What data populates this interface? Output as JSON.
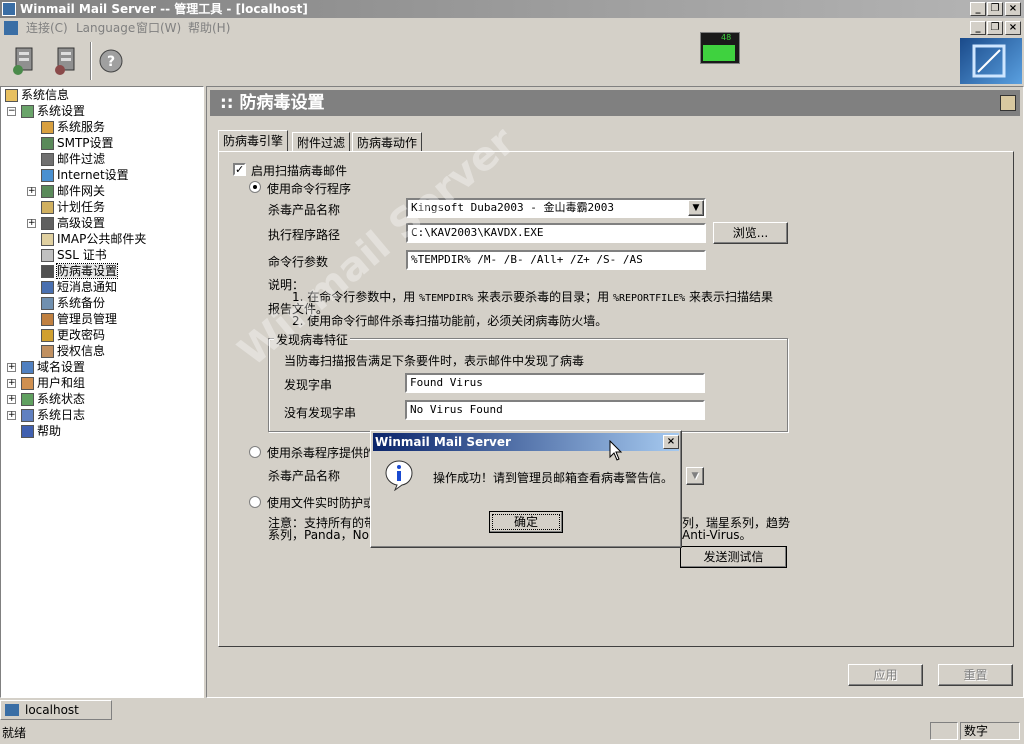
{
  "window": {
    "title": "Winmail Mail Server -- 管理工具 - [localhost]"
  },
  "menu": [
    {
      "label": "连接(C)"
    },
    {
      "label": "Language"
    },
    {
      "label": "窗口(W)"
    },
    {
      "label": "帮助(H)"
    }
  ],
  "graph": {
    "value": "48"
  },
  "tree": {
    "root": "系统信息",
    "settings": "系统设置",
    "items": [
      "系统服务",
      "SMTP设置",
      "邮件过滤",
      "Internet设置",
      "邮件网关",
      "计划任务",
      "高级设置",
      "IMAP公共邮件夹",
      "SSL 证书",
      "防病毒设置",
      "短消息通知",
      "系统备份",
      "管理员管理",
      "更改密码",
      "授权信息"
    ],
    "others": [
      "域名设置",
      "用户和组",
      "系统状态",
      "系统日志",
      "帮助"
    ]
  },
  "panel": {
    "title": ":: 防病毒设置",
    "tabs": [
      "防病毒引擎",
      "附件过滤",
      "防病毒动作"
    ],
    "enable_scan": "启用扫描病毒邮件",
    "use_cmd": "使用命令行程序",
    "product_label": "杀毒产品名称",
    "product_value": "Kingsoft Duba2003 - 金山毒霸2003",
    "path_label": "执行程序路径",
    "path_value": "C:\\KAV2003\\KAVDX.EXE",
    "browse": "浏览...",
    "params_label": "命令行参数",
    "params_value": "%TEMPDIR% /M- /B- /All+ /Z+ /S- /AS",
    "note_title": "说明：",
    "note1_prefix": "1. 在命令行参数中，用",
    "note1_var1": "%TEMPDIR%",
    "note1_mid": "来表示要杀毒的目录；用",
    "note1_var2": "%REPORTFILE%",
    "note1_suffix": "来表示扫描结果",
    "note1_cont": "报告文件。",
    "note2": "2. 使用命令行邮件杀毒扫描功能前，必须关闭病毒防火墙。",
    "virus_group": "发现病毒特征",
    "virus_desc": "当防毒扫描报告满足下条要件时，表示邮件中发现了病毒",
    "found_label": "发现字串",
    "found_value": "Found Virus",
    "nofound_label": "没有发现字串",
    "nofound_value": "No Virus Found",
    "use_api": "使用杀毒程序提供的",
    "product_label2": "杀毒产品名称",
    "use_realtime": "使用文件实时防护或",
    "note3_a": "注意：支持所有的带",
    "note3_b": "系列，Panda，Nort",
    "note3_c": "列，瑞星系列，趋势",
    "note3_d": "Anti-Virus。",
    "send_test": "发送测试信",
    "apply": "应用",
    "reset": "重置"
  },
  "dialog": {
    "title": "Winmail Mail Server",
    "message": "操作成功！请到管理员邮箱查看病毒警告信。",
    "ok": "确定"
  },
  "taskbar": {
    "item": "localhost"
  },
  "status": {
    "left": "就绪",
    "right": "数字"
  },
  "watermark": "Winmail Server"
}
